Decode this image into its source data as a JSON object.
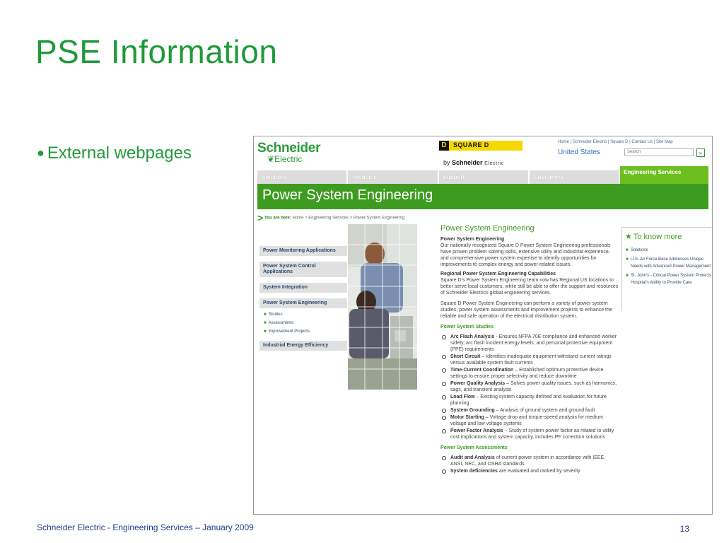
{
  "slide": {
    "title": "PSE Information",
    "bullet": "External webpages",
    "footer": "Schneider Electric - Engineering Services – January 2009",
    "page_number": "13"
  },
  "header": {
    "logo_main": "Schneider",
    "logo_sub": "Electric",
    "brand_box_letter": "D",
    "brand_name": "SQUARE D",
    "by_prefix": "by",
    "by_brand": "Schneider",
    "by_suffix": "Electric",
    "top_links": "Home  |  Schneider Electric  |  Square D  |  Contact Us  |  Site Map",
    "country": "United States",
    "search_placeholder": "Search",
    "search_button": "»"
  },
  "nav": {
    "items": [
      "Solutions",
      "Products",
      "Support",
      "Customers"
    ],
    "active": "Engineering Services"
  },
  "banner": {
    "title": "Power System Engineering"
  },
  "breadcrumb": {
    "label": "You are here:",
    "path": "Home > Engineering Services > Power System Engineering"
  },
  "left_menu": {
    "items": [
      "Power Monitoring Applications",
      "Power System Control Applications",
      "System Integration",
      "Power System Engineering"
    ],
    "sub_items": [
      "Studies",
      "Assessments",
      "Improvement Projects"
    ],
    "last_item": "Industrial Energy Efficiency"
  },
  "content": {
    "title": "Power System Engineering",
    "section1_heading": "Power System Engineering",
    "section1_text": "Our nationally recognized Square D Power System Engineering professionals have proven problem solving skills, extensive utility and industrial experience, and comprehensive power system expertise to identify opportunities for improvements to complex energy and power-related issues.",
    "section2_heading": "Regional Power System Engineering Capabilities",
    "section2_text": "Square D's Power System Engineering team now has Regional US locations to better serve local customers, while still be able to offer the support and resources of Schneider Electrics global engineering services.",
    "section3_text": "Square D Power System Engineering can perform a variety of power system studies, power system assessments and improvement projects to enhance the reliable and safe operation of the electrical distribution system.",
    "studies_heading": "Power System Studies",
    "studies": [
      {
        "name": "Arc Flash Analysis",
        "desc": " - Ensures NFPA 70E compliance and enhanced worker safety, arc flash incident energy levels, and personal protective equipment (PPE) requirements"
      },
      {
        "name": "Short Circuit",
        "desc": " – Identifies inadequate equipment withstand current ratings versus available system fault currents"
      },
      {
        "name": "Time-Current Coordination",
        "desc": " – Established optimum protective device settings to ensure proper selectivity and reduce downtime"
      },
      {
        "name": "Power Quality Analysis",
        "desc": " – Solves power quality issues, such as harmonics, sags, and transient analysis"
      },
      {
        "name": "Load Flow",
        "desc": " – Existing system capacity defined and evaluation for future planning"
      },
      {
        "name": "System Grounding",
        "desc": " – Analysis of ground system and ground fault"
      },
      {
        "name": "Motor Starting",
        "desc": " – Voltage drop and torque-speed analysis for medium voltage and low voltage systems"
      },
      {
        "name": "Power Factor Analysis",
        "desc": " – Study of system power factor as related to utility cost implications and system capacity, includes PF correction solutions"
      }
    ],
    "assessments_heading": "Power System Assessments",
    "assessments": [
      {
        "name": "Audit and Analysis",
        "desc": " of current power system in accordance with IEEE, ANSI, NEC, and OSHA standards."
      },
      {
        "name": "System deficiencies",
        "desc": " are evaluated and ranked by severity"
      }
    ]
  },
  "right_box": {
    "heading": "To know more",
    "items": [
      "Solutions",
      "U.S. Air Force Base Addresses Unique Needs with Advanced Power Management",
      "St. John's - Critical Power System Protects Hospital's Ability to Provide Care"
    ]
  },
  "colors": {
    "title_green": "#1f9a3a",
    "banner_green": "#3d9c1f",
    "active_tab": "#6cbf1f",
    "brand_yellow": "#f5d800"
  }
}
